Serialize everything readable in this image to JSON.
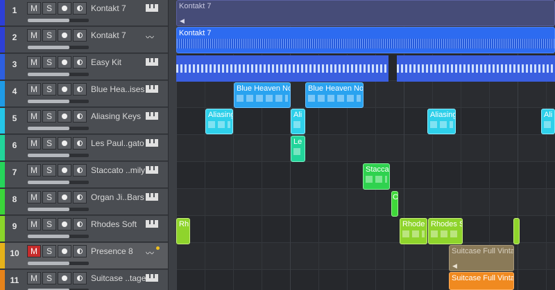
{
  "tracks": [
    {
      "num": "1",
      "name": "Kontakt 7",
      "color": "#2d3fd6",
      "icon": "instrument-icon"
    },
    {
      "num": "2",
      "name": "Kontakt 7",
      "color": "#2d3fd6",
      "icon": "audio-icon"
    },
    {
      "num": "3",
      "name": "Easy Kit",
      "color": "#2d5fe0",
      "icon": "instrument-icon"
    },
    {
      "num": "4",
      "name": "Blue Hea..ises",
      "color": "#1f9be6",
      "icon": "instrument-icon"
    },
    {
      "num": "5",
      "name": "Aliasing Keys",
      "color": "#25c6e8",
      "icon": "instrument-icon"
    },
    {
      "num": "6",
      "name": "Les Paul..gato",
      "color": "#22d49a",
      "icon": "instrument-icon"
    },
    {
      "num": "7",
      "name": "Staccato ..mily",
      "color": "#26d45a",
      "icon": "instrument-icon"
    },
    {
      "num": "8",
      "name": "Organ Ji..Bars",
      "color": "#3bd43a",
      "icon": "instrument-icon"
    },
    {
      "num": "9",
      "name": "Rhodes Soft",
      "color": "#8bd42a",
      "icon": "instrument-icon"
    },
    {
      "num": "10",
      "name": "Presence 8",
      "color": "#e6b21a",
      "icon": "audio-icon",
      "muted": true,
      "selected": true
    },
    {
      "num": "11",
      "name": "Suitcase ..tage",
      "color": "#e6831a",
      "icon": "instrument-icon"
    }
  ],
  "buttons": {
    "mute": "M",
    "solo": "S"
  },
  "clips": {
    "kontakt_top": "Kontakt 7",
    "kontakt_audio": "Kontakt 7",
    "blue_heaven_1": "Blue Heaven No",
    "blue_heaven_2": "Blue Heaven No",
    "aliasing_1": "Aliasing",
    "aliasing_2": "Ali",
    "aliasing_3": "Aliasing",
    "aliasing_4": "Ali",
    "les_paul": "Le",
    "staccato": "Stacca",
    "organ": "C",
    "rhodes_1": "Rh",
    "rhodes_2": "Rhode",
    "rhodes_3": "Rhodes S",
    "suitcase_1": "Suitcase Full Vinta",
    "suitcase_2": "Suitcase Full Vinta"
  },
  "colors": {
    "blue": "#2d6bf0",
    "lightblue": "#2aa3f0",
    "cyan": "#2ed0ea",
    "teal": "#22d49a",
    "green": "#2fd24f",
    "lime": "#8fd42c",
    "tan": "#8a7a58",
    "orange": "#f08a20"
  }
}
